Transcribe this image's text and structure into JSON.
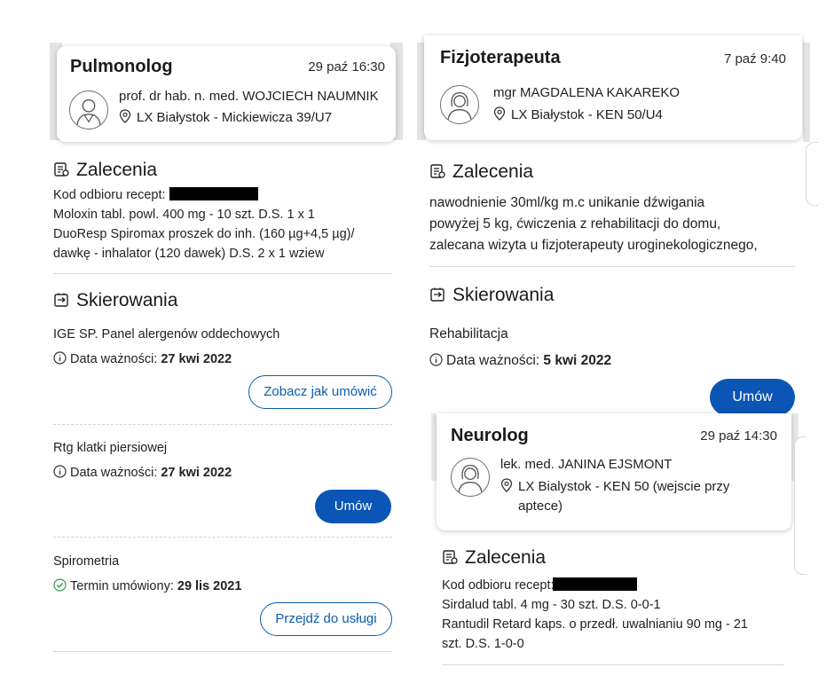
{
  "left": {
    "card": {
      "title": "Pulmonolog",
      "date": "29 paź 16:30",
      "doctor": "prof. dr hab. n. med. WOJCIECH NAUMNIK",
      "location": "LX Białystok - Mickiewicza 39/U7"
    },
    "recommendations": {
      "heading": "Zalecenia",
      "code_label": "Kod odbioru recept:",
      "lines": [
        "Moloxin tabl. powl. 400 mg - 10 szt. D.S. 1 x 1",
        "DuoResp Spiromax proszek do inh. (160 µg+4,5 µg)/",
        "dawkę - inhalator (120 dawek) D.S. 2 x 1 wziew"
      ]
    },
    "referrals": {
      "heading": "Skierowania",
      "items": [
        {
          "name": "IGE SP. Panel alergenów oddechowych",
          "label": "Data ważności:",
          "value": "27 kwi 2022",
          "button": "Zobacz jak umówić"
        },
        {
          "name": "Rtg klatki piersiowej",
          "label": "Data ważności:",
          "value": "27 kwi 2022",
          "button": "Umów"
        },
        {
          "name": "Spirometria",
          "label": "Termin umówiony:",
          "value": "29 lis 2021",
          "button": "Przejdź do usługi"
        }
      ]
    }
  },
  "right": {
    "card": {
      "title": "Fizjoterapeuta",
      "date": "7 paź 9:40",
      "doctor": "mgr MAGDALENA KAKAREKO",
      "location": "LX Białystok - KEN 50/U4"
    },
    "recommendations": {
      "heading": "Zalecenia",
      "lines": [
        "nawodnienie 30ml/kg m.c unikanie dźwigania",
        "powyżej 5 kg, ćwiczenia z rehabilitacji do domu,",
        "zalecana wizyta u fizjoterapeuty uroginekologicznego,"
      ]
    },
    "referrals": {
      "heading": "Skierowania",
      "name": "Rehabilitacja",
      "label": "Data ważności:",
      "value": "5 kwi 2022",
      "button": "Umów"
    },
    "card2": {
      "title": "Neurolog",
      "date": "29 paź 14:30",
      "doctor": "lek. med. JANINA EJSMONT",
      "location_line1": "LX Bialystok - KEN 50 (wejscie przy",
      "location_line2": "aptece)"
    },
    "recommendations2": {
      "heading": "Zalecenia",
      "code_label": "Kod odbioru recept:",
      "lines": [
        "Sirdalud tabl. 4 mg - 30 szt. D.S. 0-0-1",
        "Rantudil Retard kaps. o przedł. uwalnianiu 90 mg - 21",
        "szt. D.S. 1-0-0"
      ]
    }
  }
}
